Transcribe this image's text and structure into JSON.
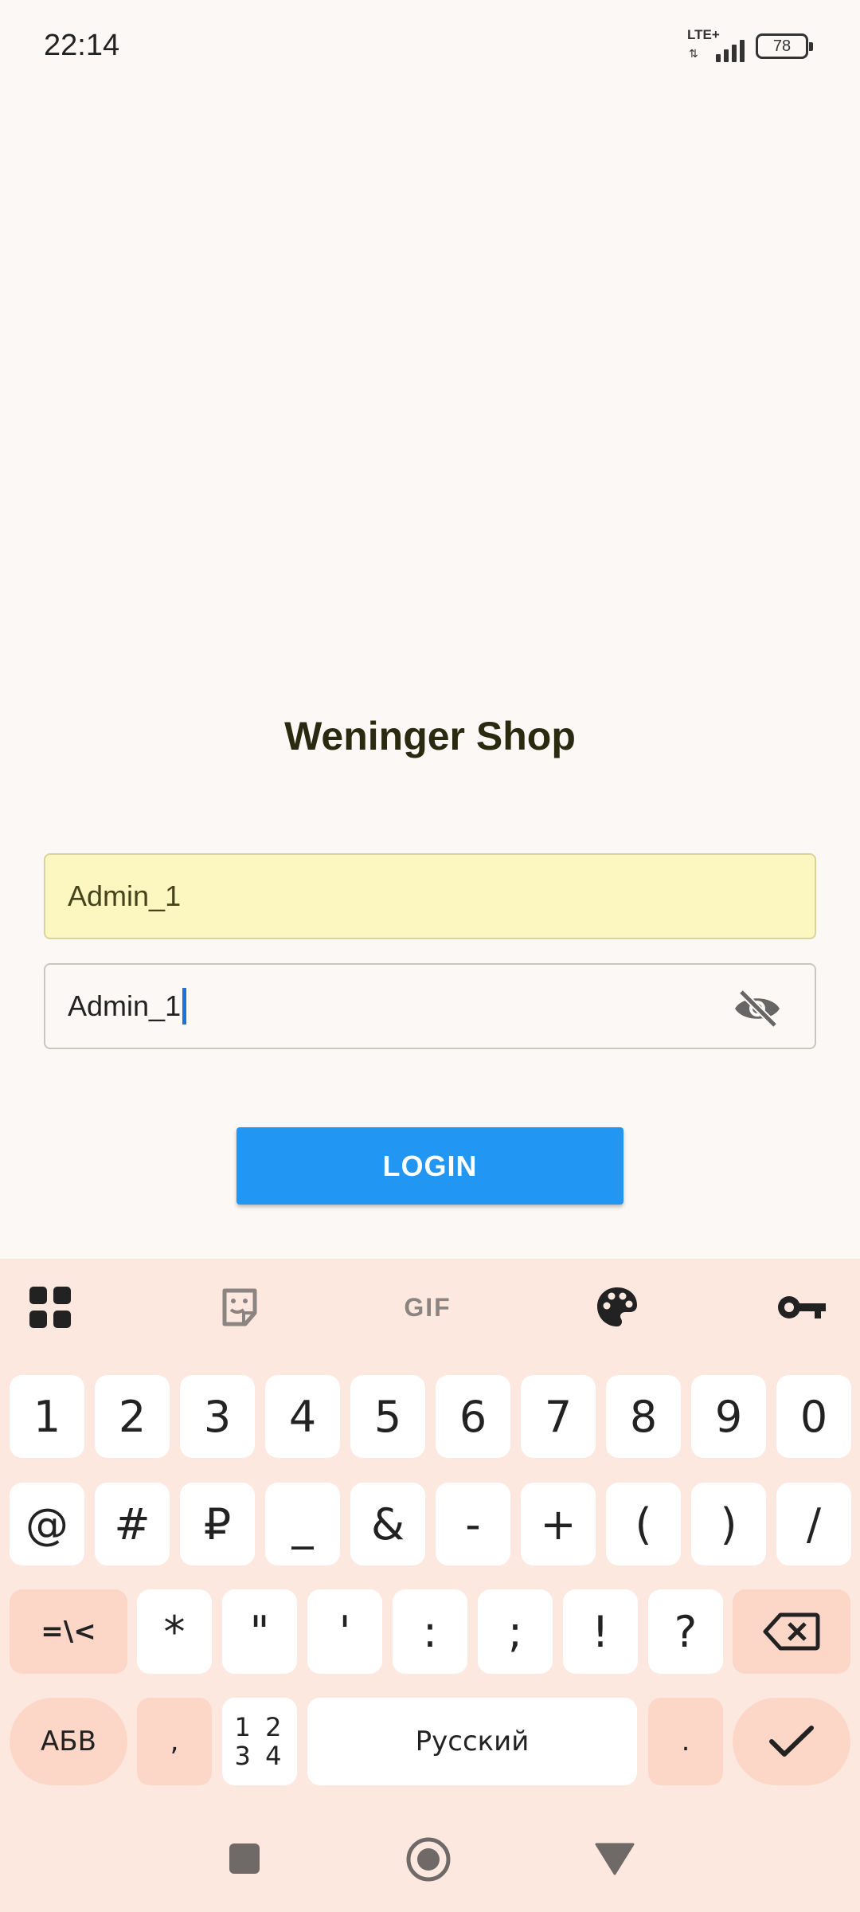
{
  "status_bar": {
    "time": "22:14",
    "network": "LTE+",
    "battery": "78"
  },
  "app": {
    "title": "Weninger Shop",
    "username_value": "Admin_1",
    "password_value": "Admin_1",
    "login_label": "LOGIN"
  },
  "keyboard": {
    "toolbar_icons": [
      "apps-grid-icon",
      "sticker-icon",
      "gif-icon",
      "palette-icon",
      "key-icon"
    ],
    "gif_label": "GIF",
    "row1": [
      "1",
      "2",
      "3",
      "4",
      "5",
      "6",
      "7",
      "8",
      "9",
      "0"
    ],
    "row2": [
      "@",
      "#",
      "₽",
      "_",
      "&",
      "-",
      "+",
      "(",
      ")",
      "/"
    ],
    "row3_shift": "=\\<",
    "row3": [
      "*",
      "\"",
      "'",
      ":",
      ";",
      "!",
      "?"
    ],
    "alpha_key": "АБВ",
    "comma": ",",
    "numpad_top": "1 2",
    "numpad_bottom": "3 4",
    "space_label": "Русский",
    "period": "."
  },
  "colors": {
    "accent": "#2196f3",
    "autofill": "#fcf6c0",
    "keyboard_bg": "#fde8e0",
    "fn_key": "#fcd7c8"
  }
}
